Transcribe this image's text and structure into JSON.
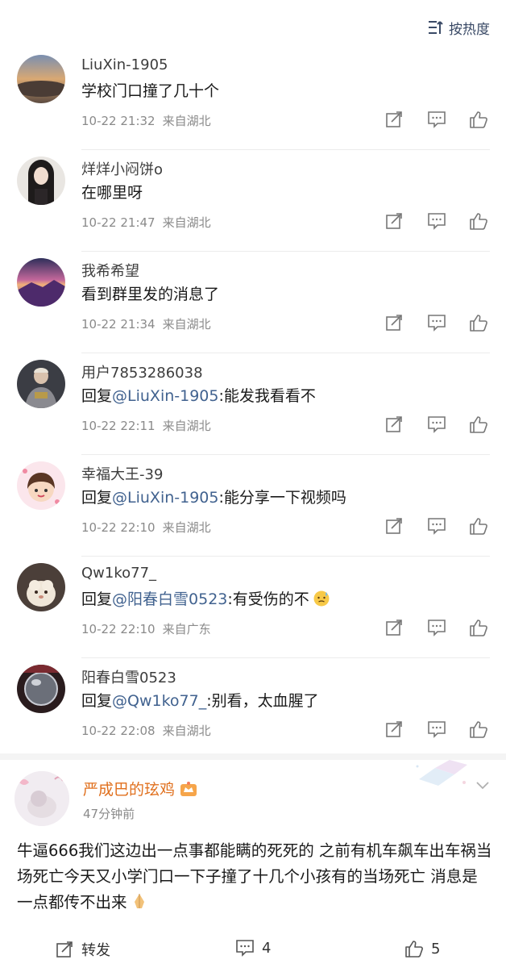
{
  "sort": {
    "label": "按热度",
    "icon": "sort-lines-icon"
  },
  "comments": [
    {
      "user": "LiuXin-1905",
      "text": "学校门口撞了几十个",
      "mention": "",
      "time": "10-22 21:32",
      "location": "来自湖北"
    },
    {
      "user": "烊烊小闷饼o",
      "text": "在哪里呀",
      "mention": "",
      "time": "10-22 21:47",
      "location": "来自湖北"
    },
    {
      "user": "我希希望",
      "text": "看到群里发的消息了",
      "mention": "",
      "time": "10-22 21:34",
      "location": "来自湖北"
    },
    {
      "user": "用户7853286038",
      "reply_prefix": "回复",
      "mention": "@LiuXin-1905",
      "text": ":能发我看看不",
      "time": "10-22 22:11",
      "location": "来自湖北"
    },
    {
      "user": "幸福大王-39",
      "reply_prefix": "回复",
      "mention": "@LiuXin-1905",
      "text": ":能分享一下视频吗",
      "time": "10-22 22:10",
      "location": "来自湖北"
    },
    {
      "user": "Qw1ko77_",
      "reply_prefix": "回复",
      "mention": "@阳春白雪0523",
      "text": ":有受伤的不",
      "time": "10-22 22:10",
      "location": "来自广东"
    },
    {
      "user": "阳春白雪0523",
      "reply_prefix": "回复",
      "mention": "@Qw1ko77_",
      "text": ":别看，太血腥了",
      "time": "10-22 22:08",
      "location": "来自湖北"
    }
  ],
  "post": {
    "author": "严成巴的玹鸡",
    "time": "47分钟前",
    "text": "牛逼666我们这边出一点事都能瞒的死死的 之前有机车飙车出车祸当场死亡今天又小学门口一下子撞了十几个小孩有的当场死亡 消息是一点都传不出来",
    "repost_label": "转发",
    "comment_count": "4",
    "like_count": "5"
  },
  "colors": {
    "mention": "#41628f",
    "author": "#e0701e",
    "meta": "#8a8a8a"
  }
}
